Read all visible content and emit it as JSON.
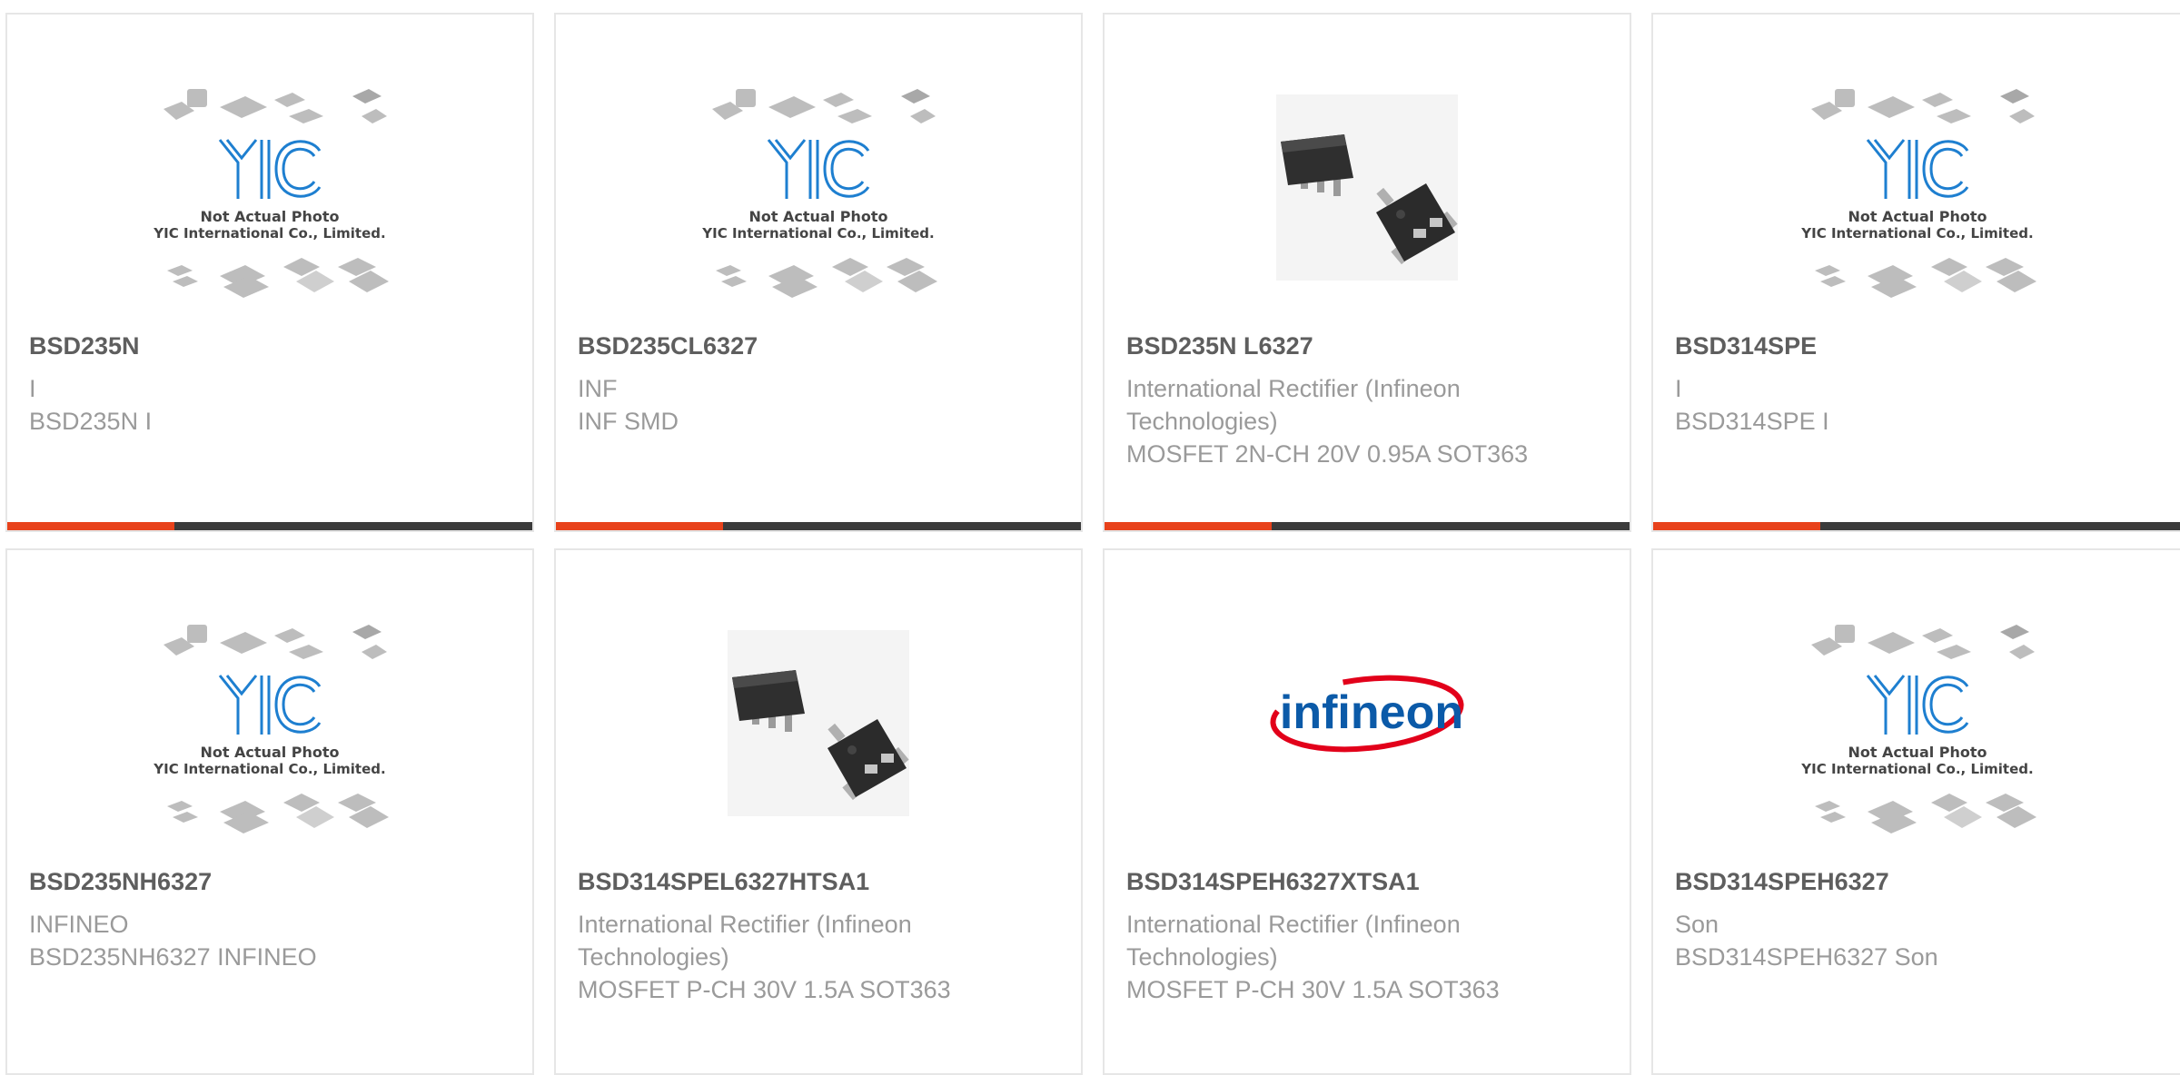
{
  "colors": {
    "accent": "#e8421b",
    "bar": "#3b3b3b",
    "title": "#5e5e5e",
    "text": "#9a9a9a",
    "yic_blue": "#1e7fd0",
    "infineon_red": "#e2001a",
    "infineon_blue": "#0b5aa8"
  },
  "placeholder": {
    "line1": "Not Actual Photo",
    "line2": "YIC International Co., Limited.",
    "logo": "YIC"
  },
  "infineon_logo_text": "infineon",
  "products": [
    {
      "name": "BSD235N",
      "brand": "I",
      "desc": "BSD235N I",
      "image": "placeholder"
    },
    {
      "name": "BSD235CL6327",
      "brand": "INF",
      "desc": "INF SMD",
      "image": "placeholder"
    },
    {
      "name": "BSD235N L6327",
      "brand": "International Rectifier (Infineon Technologies)",
      "desc": "MOSFET 2N-CH 20V 0.95A SOT363",
      "image": "chip-photo"
    },
    {
      "name": "BSD314SPE",
      "brand": "I",
      "desc": "BSD314SPE I",
      "image": "placeholder"
    },
    {
      "name": "BSD235NH6327",
      "brand": "INFINEO",
      "desc": "BSD235NH6327 INFINEO",
      "image": "placeholder"
    },
    {
      "name": "BSD314SPEL6327HTSA1",
      "brand": "International Rectifier (Infineon Technologies)",
      "desc": "MOSFET P-CH 30V 1.5A SOT363",
      "image": "chip-photo"
    },
    {
      "name": "BSD314SPEH6327XTSA1",
      "brand": "International Rectifier (Infineon Technologies)",
      "desc": "MOSFET P-CH 30V 1.5A SOT363",
      "image": "infineon-logo"
    },
    {
      "name": "BSD314SPEH6327",
      "brand": "Son",
      "desc": "BSD314SPEH6327 Son",
      "image": "placeholder"
    }
  ]
}
